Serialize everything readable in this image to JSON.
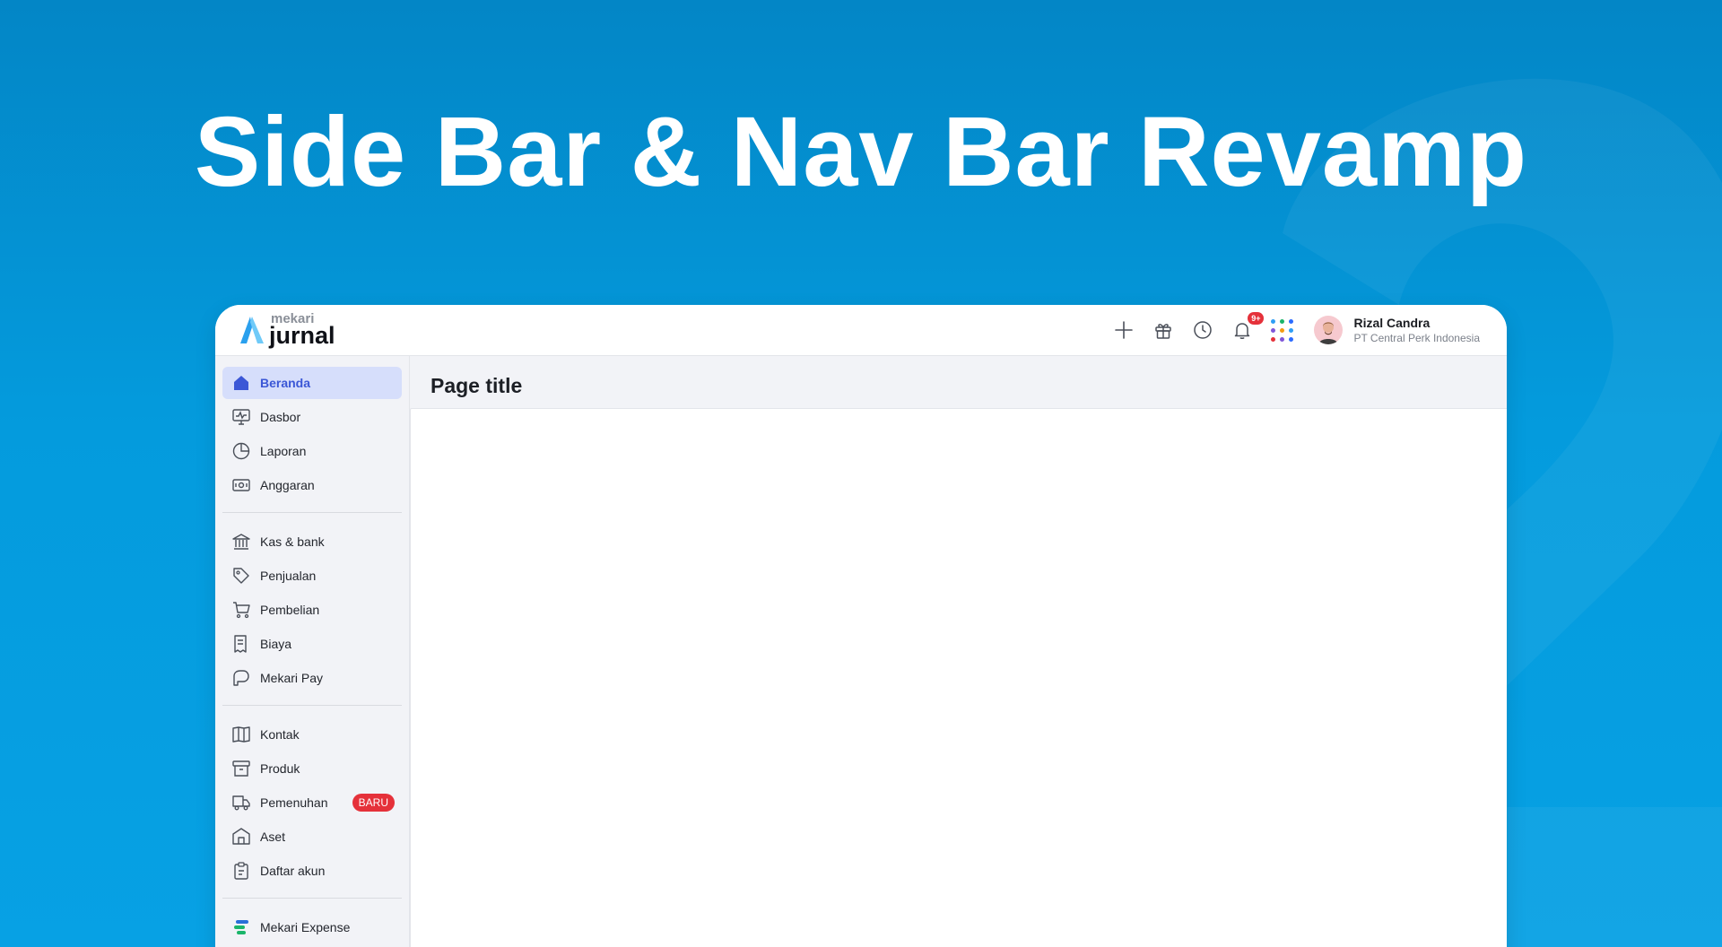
{
  "hero": {
    "title": "Side Bar & Nav Bar Revamp"
  },
  "logo": {
    "small": "mekari",
    "big": "jurnal"
  },
  "navbar": {
    "notification_badge": "9+",
    "apps_dot_colors": [
      "#2e9ef5",
      "#1bb56a",
      "#2b6bff",
      "#7f56d9",
      "#f39c12",
      "#2e9ef5",
      "#e5313a",
      "#7f56d9",
      "#2b6bff"
    ],
    "profile": {
      "name": "Rizal Candra",
      "company": "PT Central Perk Indonesia"
    }
  },
  "sidebar": {
    "groups": [
      {
        "items": [
          {
            "label": "Beranda",
            "icon": "home-icon",
            "active": true
          },
          {
            "label": "Dasbor",
            "icon": "monitor-icon"
          },
          {
            "label": "Laporan",
            "icon": "pie-chart-icon"
          },
          {
            "label": "Anggaran",
            "icon": "budget-icon"
          }
        ]
      },
      {
        "items": [
          {
            "label": "Kas & bank",
            "icon": "bank-icon"
          },
          {
            "label": "Penjualan",
            "icon": "tag-icon"
          },
          {
            "label": "Pembelian",
            "icon": "cart-icon"
          },
          {
            "label": "Biaya",
            "icon": "receipt-icon"
          },
          {
            "label": "Mekari Pay",
            "icon": "pay-icon"
          }
        ]
      },
      {
        "items": [
          {
            "label": "Kontak",
            "icon": "contact-book-icon"
          },
          {
            "label": "Produk",
            "icon": "box-icon"
          },
          {
            "label": "Pemenuhan",
            "icon": "truck-icon",
            "badge": "BARU"
          },
          {
            "label": "Aset",
            "icon": "building-icon"
          },
          {
            "label": "Daftar akun",
            "icon": "clipboard-icon"
          }
        ]
      },
      {
        "items": [
          {
            "label": "Mekari Expense",
            "icon": "mekari-expense-icon"
          }
        ]
      }
    ]
  },
  "main": {
    "page_title": "Page title"
  },
  "colors": {
    "accent": "#3b57d6",
    "active_bg": "#d6defb",
    "badge": "#e5313a",
    "background_blue": "#049bdd"
  }
}
